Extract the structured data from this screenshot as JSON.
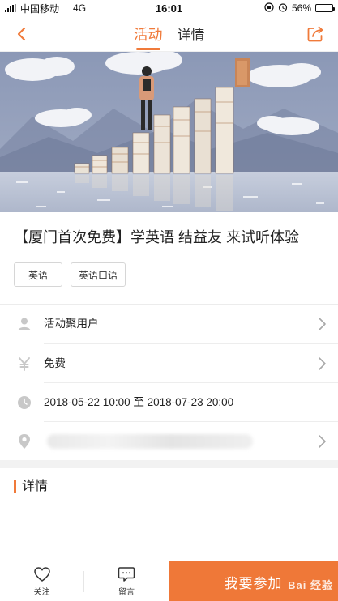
{
  "status_bar": {
    "carrier": "中国移动",
    "network": "4G",
    "time": "16:01",
    "battery_text": "56%",
    "battery_level": 0.56
  },
  "nav": {
    "tabs": [
      {
        "label": "活动",
        "active": true
      },
      {
        "label": "详情",
        "active": false
      }
    ],
    "accent_color": "#f07a3a"
  },
  "event": {
    "title": "【厦门首次免费】学英语 结益友 来试听体验",
    "tags": [
      "英语",
      "英语口语"
    ],
    "organizer": "活动聚用户",
    "price": "免费",
    "datetime": "2018-05-22 10:00 至 2018-07-23 20:00"
  },
  "details": {
    "header_label": "详情"
  },
  "bottom_bar": {
    "follow_label": "关注",
    "comment_label": "留言",
    "join_label": "我要参加",
    "watermark": "Bai 经验"
  }
}
